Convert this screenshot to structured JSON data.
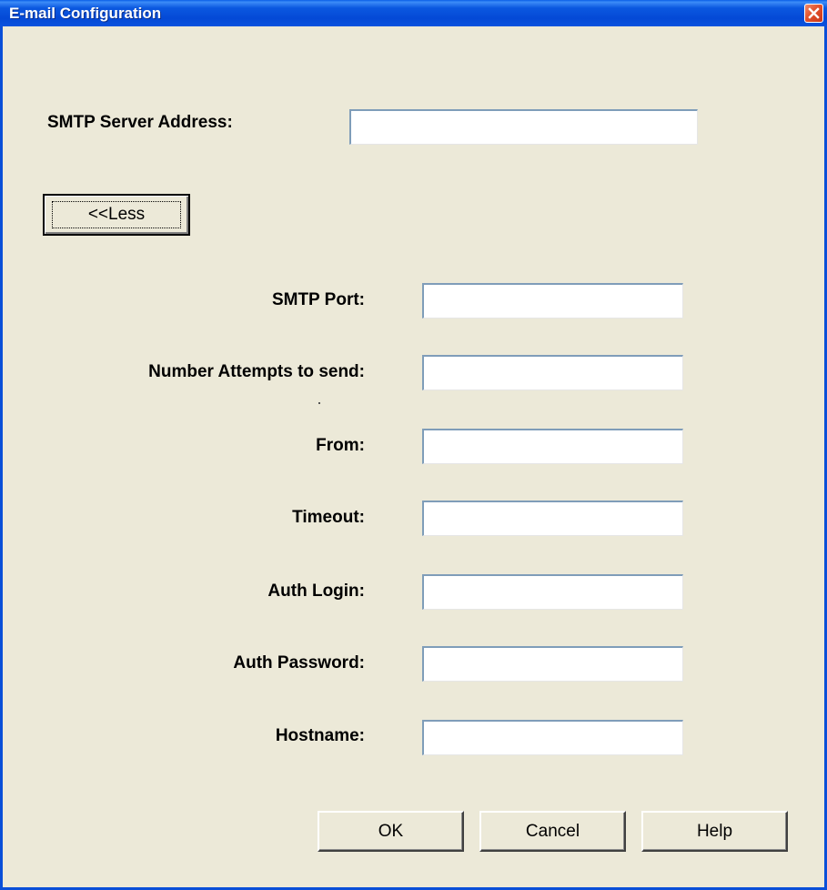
{
  "window": {
    "title": "E-mail Configuration",
    "close_icon": "close-icon"
  },
  "fields": {
    "smtp_server_address": {
      "label": "SMTP Server Address:",
      "value": ""
    },
    "smtp_port": {
      "label": "SMTP Port:",
      "value": ""
    },
    "number_attempts": {
      "label": "Number Attempts to send:",
      "value": ""
    },
    "from": {
      "label": "From:",
      "value": ""
    },
    "timeout": {
      "label": "Timeout:",
      "value": ""
    },
    "auth_login": {
      "label": "Auth Login:",
      "value": ""
    },
    "auth_password": {
      "label": "Auth Password:",
      "value": ""
    },
    "hostname": {
      "label": "Hostname:",
      "value": ""
    }
  },
  "buttons": {
    "less": "<<Less",
    "ok": "OK",
    "cancel": "Cancel",
    "help": "Help"
  },
  "colors": {
    "titlebar": "#0449d6",
    "window_face": "#ece9d8",
    "close_button": "#e2512b"
  }
}
